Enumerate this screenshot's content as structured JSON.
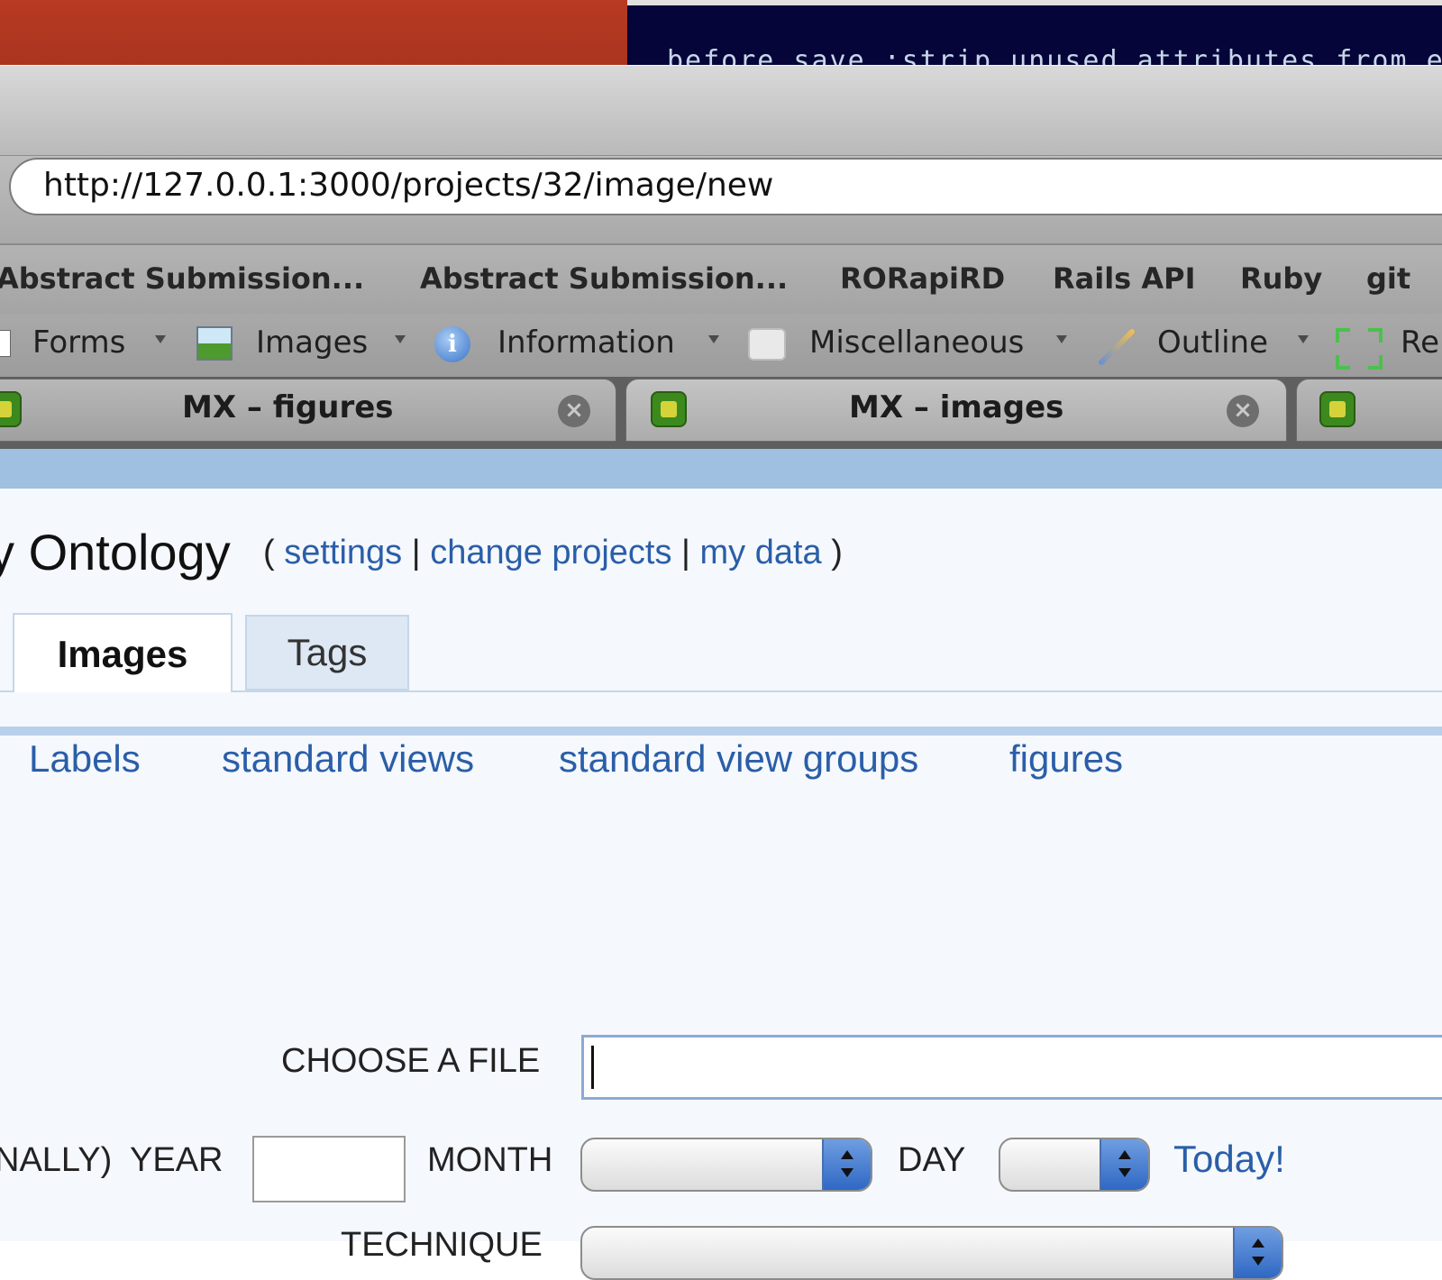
{
  "desktop": {
    "terminal_text": "before_save :strip_unused_attributes from_el"
  },
  "browser": {
    "url": "http://127.0.0.1:3000/projects/32/image/new",
    "bookmarks": [
      {
        "label": "Abstract Submission..."
      },
      {
        "label": "Abstract Submission..."
      },
      {
        "label": "RORapiRD"
      },
      {
        "label": "Rails API"
      },
      {
        "label": "Ruby"
      },
      {
        "label": "git"
      }
    ],
    "toolbar": [
      {
        "label": "Forms",
        "icon": "form-icon"
      },
      {
        "label": "Images",
        "icon": "image-icon"
      },
      {
        "label": "Information",
        "icon": "info-icon"
      },
      {
        "label": "Miscellaneous",
        "icon": "puzzle-icon"
      },
      {
        "label": "Outline",
        "icon": "pencil-icon"
      },
      {
        "label": "Re",
        "icon": "resize-icon"
      }
    ],
    "tabs": [
      {
        "title": "MX – figures"
      },
      {
        "title": "MX – images"
      }
    ]
  },
  "page": {
    "title": "Ontology",
    "title_prefix": "y",
    "links_open": "(",
    "links_close": ")",
    "link_settings": "settings",
    "link_change_projects": "change projects",
    "link_my_data": "my data",
    "separator": "|",
    "tabs": [
      {
        "label": "Images"
      },
      {
        "label": "Tags"
      }
    ],
    "subnav": [
      {
        "label": "Labels"
      },
      {
        "label": "standard views"
      },
      {
        "label": "standard view groups"
      },
      {
        "label": "figures"
      }
    ]
  },
  "form": {
    "choose_file_label": "Choose a file",
    "optionally_label": "nally)",
    "year_label": "Year",
    "month_label": "Month",
    "day_label": "Day",
    "today_link": "Today!",
    "technique_label": "Technique",
    "year_value": "",
    "month_value": "",
    "day_value": ""
  },
  "colors": {
    "link": "#2a5ea8",
    "accent": "#9fc0e0"
  }
}
